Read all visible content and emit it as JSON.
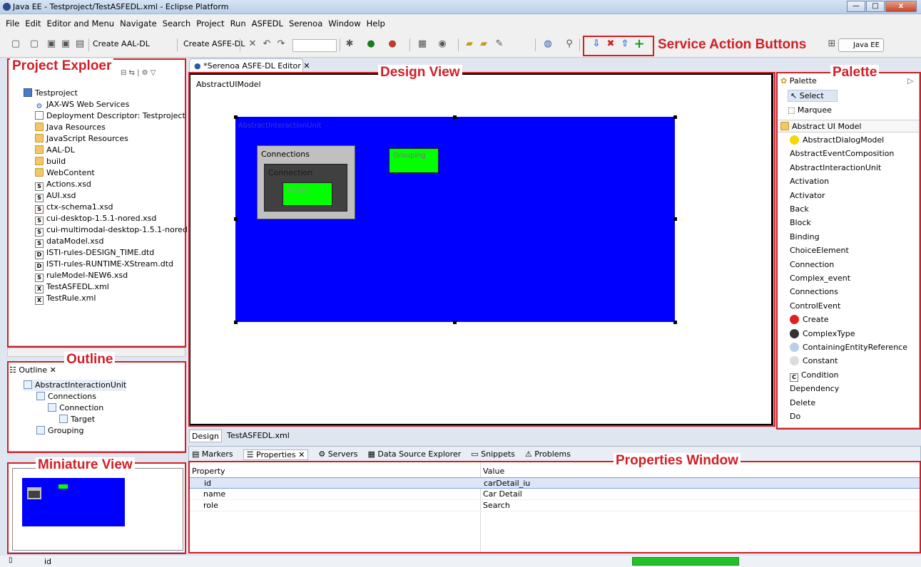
{
  "window": {
    "title": "Java EE - Testproject/TestASFEDL.xml - Eclipse Platform",
    "min": "—",
    "max": "□",
    "close": "x"
  },
  "menu": [
    "File",
    "Edit",
    "Editor and Menu",
    "Navigate",
    "Search",
    "Project",
    "Run",
    "ASFEDL",
    "Serenoa",
    "Window",
    "Help"
  ],
  "toolbar": {
    "create_aal": "Create AAL-DL",
    "create_asfe": "Create ASFE-DL",
    "perspective": "Java EE",
    "service_icons": {
      "down": "⇩",
      "delete": "✖",
      "up": "⇧",
      "add": "+"
    }
  },
  "annotations": {
    "service_action": "Service Action Buttons",
    "project_explorer": "Project Exploer",
    "design_view": "Design View",
    "palette": "Palette",
    "outline": "Outline",
    "miniature": "Miniature View",
    "properties": "Properties Window"
  },
  "project_explorer": {
    "items": [
      "Testproject",
      "JAX-WS Web Services",
      "Deployment Descriptor: Testproject",
      "Java Resources",
      "JavaScript Resources",
      "AAL-DL",
      "build",
      "WebContent",
      "Actions.xsd",
      "AUI.xsd",
      "ctx-schema1.xsd",
      "cui-desktop-1.5.1-nored.xsd",
      "cui-multimodal-desktop-1.5.1-nored.xsd",
      "dataModel.xsd",
      "ISTI-rules-DESIGN_TIME.dtd",
      "ISTI-rules-RUNTIME-XStream.dtd",
      "ruleModel-NEW6.xsd",
      "TestASFEDL.xml",
      "TestRule.xml"
    ]
  },
  "editor": {
    "tab": "*Serenoa ASFE-DL Editor",
    "root_label": "AbstractUIModel",
    "unit_label": "AbstractInteractionUnit",
    "connections_label": "Connections",
    "connection_label": "Connection",
    "target_label": "Target",
    "grouping_label": "Grouping",
    "bottom_tabs": [
      "Design",
      "TestASFEDL.xml"
    ]
  },
  "palette": {
    "header": "Palette",
    "tools": [
      "Select",
      "Marquee"
    ],
    "drawer": "Abstract UI Model",
    "items": [
      "AbstractDialogModel",
      "AbstractEventComposition",
      "AbstractInteractionUnit",
      "Activation",
      "Activator",
      "Back",
      "Block",
      "Binding",
      "ChoiceElement",
      "Connection",
      "Complex_event",
      "Connections",
      "ControlEvent",
      "Create",
      "ComplexType",
      "ContainingEntityReference",
      "Constant",
      "Condition",
      "Dependency",
      "Delete",
      "Do"
    ],
    "icon_colors": {
      "AbstractDialogModel": "#f5d800",
      "Create": "#e02020",
      "ComplexType": "#333333",
      "ContainingEntityReference": "#b9cfe8",
      "Constant": "#dcdcdc"
    },
    "condition_glyph": "C"
  },
  "outline": {
    "tab": "Outline",
    "items": [
      "AbstractInteractionUnit",
      "Connections",
      "Connection",
      "Target",
      "Grouping"
    ]
  },
  "bottom": {
    "tabs": [
      "Markers",
      "Properties",
      "Servers",
      "Data Source Explorer",
      "Snippets",
      "Problems"
    ],
    "headers": [
      "Property",
      "Value"
    ],
    "rows": [
      [
        "id",
        "carDetail_iu"
      ],
      [
        "name",
        "Car Detail"
      ],
      [
        "role",
        "Search"
      ]
    ]
  },
  "status": {
    "text": "id"
  },
  "colors": {
    "unit": "#0000ff",
    "green": "#00ff00",
    "annotation": "#d21e26",
    "connections_bg": "#c0c0c0",
    "connection_bg": "#404040"
  }
}
